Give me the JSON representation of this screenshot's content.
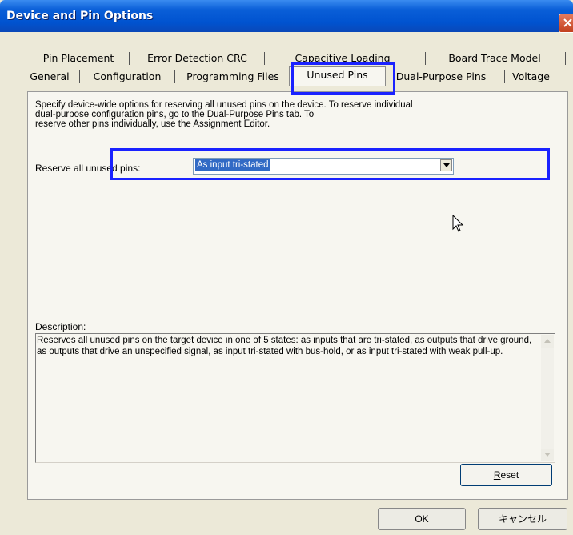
{
  "window": {
    "title": "Device and Pin Options",
    "close_label": "✕"
  },
  "tabs_row1": [
    {
      "label": "Pin Placement"
    },
    {
      "label": "Error Detection CRC"
    },
    {
      "label": "Capacitive Loading"
    },
    {
      "label": "Board Trace Model"
    }
  ],
  "tabs_row2": [
    {
      "label": "General"
    },
    {
      "label": "Configuration"
    },
    {
      "label": "Programming Files"
    },
    {
      "label": "Unused Pins",
      "active": true
    },
    {
      "label": "Dual-Purpose Pins"
    },
    {
      "label": "Voltage"
    }
  ],
  "panel": {
    "intro_line1": "Specify device-wide options for reserving all unused pins on the device. To reserve individual",
    "intro_line2": "dual-purpose configuration pins, go to the Dual-Purpose Pins tab. To",
    "intro_line3": "reserve other pins individually, use the Assignment Editor.",
    "reserve_label": "Reserve all unused pins:",
    "reserve_value": "As input tri-stated",
    "description_label": "Description:",
    "description_text": "Reserves all unused pins on the target device in one of 5 states: as inputs that are tri-stated, as outputs that drive ground, as outputs that drive an unspecified signal, as input tri-stated with bus-hold, or as input tri-stated with weak pull-up.",
    "reset_label_prefix": "R",
    "reset_label_rest": "eset"
  },
  "footer": {
    "ok_label": "OK",
    "cancel_label": "キャンセル"
  },
  "colors": {
    "highlight": "#1a22ff",
    "selection": "#316ac5",
    "titlebar": "#0053d0"
  }
}
